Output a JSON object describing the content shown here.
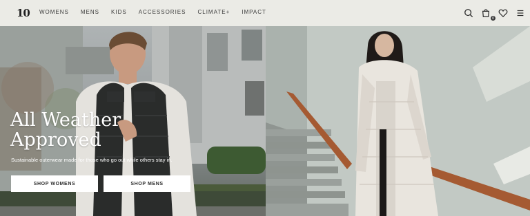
{
  "header": {
    "logo_text": "10",
    "nav": [
      "WOMENS",
      "MENS",
      "KIDS",
      "ACCESSORIES",
      "CLIMATE+",
      "IMPACT"
    ],
    "icons": [
      "search-icon",
      "cart-icon",
      "heart-icon",
      "menu-icon"
    ],
    "cart_count": "0"
  },
  "hero": {
    "headline_line1": "All Weather",
    "headline_line2": "Approved",
    "subheadline": "Sustainable outerwear made for those who go out while others stay in.",
    "cta_women": "SHOP WOMENS",
    "cta_men": "SHOP MENS"
  },
  "colors": {
    "header_bg": "#ebebe6",
    "text_dark": "#2b2b2b",
    "button_bg": "#ffffff",
    "railing": "#a55a32"
  }
}
